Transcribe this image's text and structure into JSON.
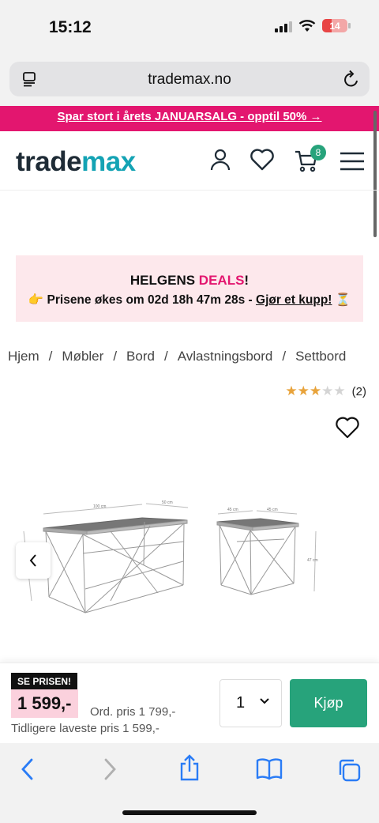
{
  "status_bar": {
    "time": "15:12",
    "battery": "14"
  },
  "browser": {
    "url": "trademax.no"
  },
  "promo": {
    "text": "Spar stort i årets JANUARSALG - opptil 50% →"
  },
  "header": {
    "logo_part1": "trade",
    "logo_part2": "max",
    "cart_count": "8"
  },
  "deals": {
    "title_part1": "HELGENS ",
    "title_part2": "DEALS",
    "title_part3": "!",
    "emoji_left": "👉",
    "countdown_text": "Prisene økes om 02d 18h 47m 28s - ",
    "link_text": "Gjør et kupp!",
    "emoji_right": "⏳"
  },
  "breadcrumb": [
    "Hjem",
    "Møbler",
    "Bord",
    "Avlastningsbord",
    "Settbord"
  ],
  "breadcrumb_sep": "/",
  "rating": {
    "stars": 3,
    "max": 5,
    "count_label": "(2)"
  },
  "product_image": {
    "large_dims": [
      "100 cm",
      "50 cm"
    ],
    "small_dims": [
      "45 cm",
      "45 cm",
      "47 cm"
    ]
  },
  "buy_bar": {
    "badge": "SE PRISEN!",
    "price": "1 599,-",
    "original_price": "Ord. pris 1 799,-",
    "lowest_price": "Tidligere laveste pris 1 599,-",
    "quantity": "1",
    "buy_label": "Kjøp"
  },
  "colors": {
    "brand_pink": "#e3166f",
    "brand_teal": "#14a3b4",
    "buy_green": "#27a37b",
    "star": "#e8a33b"
  }
}
